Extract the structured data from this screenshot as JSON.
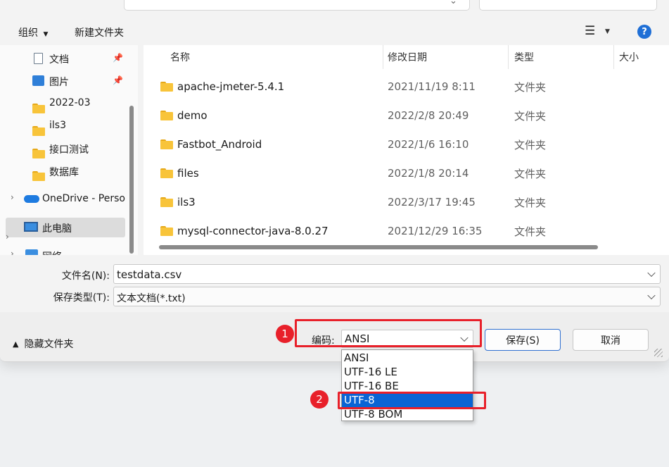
{
  "toolbar": {
    "organize_label": "组织",
    "new_folder_label": "新建文件夹",
    "help_label": "?"
  },
  "sidebar": {
    "items": [
      {
        "label": "文档",
        "icon": "document-icon",
        "pinned": true
      },
      {
        "label": "图片",
        "icon": "picture-icon",
        "pinned": true
      },
      {
        "label": "2022-03",
        "icon": "folder-icon"
      },
      {
        "label": "ils3",
        "icon": "folder-icon"
      },
      {
        "label": "接口测试",
        "icon": "folder-icon"
      },
      {
        "label": "数据库",
        "icon": "folder-icon"
      },
      {
        "label": "OneDrive - Perso",
        "icon": "onedrive-icon"
      },
      {
        "label": "此电脑",
        "icon": "computer-icon",
        "selected": true
      },
      {
        "label": "网络",
        "icon": "network-icon"
      }
    ]
  },
  "columns": {
    "name": "名称",
    "modified": "修改日期",
    "type": "类型",
    "size": "大小"
  },
  "files": [
    {
      "name": "apache-jmeter-5.4.1",
      "modified": "2021/11/19 8:11",
      "type": "文件夹"
    },
    {
      "name": "demo",
      "modified": "2022/2/8 20:49",
      "type": "文件夹"
    },
    {
      "name": "Fastbot_Android",
      "modified": "2022/1/6 16:10",
      "type": "文件夹"
    },
    {
      "name": "files",
      "modified": "2022/1/8 20:14",
      "type": "文件夹"
    },
    {
      "name": "ils3",
      "modified": "2022/3/17 19:45",
      "type": "文件夹"
    },
    {
      "name": "mysql-connector-java-8.0.27",
      "modified": "2021/12/29 16:35",
      "type": "文件夹"
    }
  ],
  "form": {
    "filename_label": "文件名(N):",
    "filename_value": "testdata.csv",
    "filetype_label": "保存类型(T):",
    "filetype_value": "文本文档(*.txt)",
    "encoding_label": "编码:",
    "encoding_value": "ANSI"
  },
  "footer": {
    "hide_folders_label": "隐藏文件夹",
    "save_label": "保存(S)",
    "cancel_label": "取消"
  },
  "encoding_options": [
    "ANSI",
    "UTF-16 LE",
    "UTF-16 BE",
    "UTF-8",
    "UTF-8 BOM"
  ],
  "encoding_selected": "UTF-8",
  "annotations": {
    "badge1": "1",
    "badge2": "2"
  },
  "colors": {
    "accent": "#0a64d4",
    "annotation": "#e8202a",
    "folder": "#f8c43a"
  }
}
